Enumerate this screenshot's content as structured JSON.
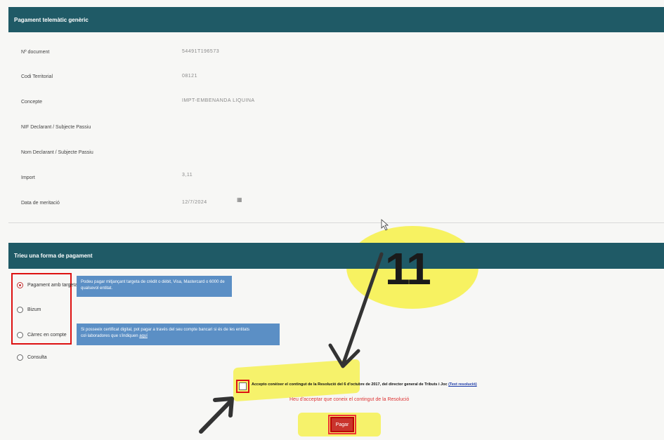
{
  "header": {
    "title": "Pagament telemàtic genèric"
  },
  "fields": [
    {
      "label": "Nº document",
      "value": "54491T196573"
    },
    {
      "label": "Codi Territorial",
      "value": "08121"
    },
    {
      "label": "Concepte",
      "value": "IMPT-EMBENANDA LIQUINA"
    },
    {
      "label": "NIF Declarant / Subjecte Passiu",
      "value": ""
    },
    {
      "label": "Nom Declarant / Subjecte Passiu",
      "value": ""
    },
    {
      "label": "Import",
      "value": "3,11"
    },
    {
      "label": "Data de meritació",
      "value": "12/7/2024"
    }
  ],
  "payment": {
    "title": "Trieu una forma de pagament",
    "options": [
      {
        "label": "Pagament amb targeta",
        "checked": true
      },
      {
        "label": "Bizum",
        "checked": false
      },
      {
        "label": "Càrrec en compte",
        "checked": false
      },
      {
        "label": "Consulta",
        "checked": false
      }
    ],
    "card_info": "Podeu pagar mitjançant targeta de crèdit o dèbit, Visa, Mastercard o 6000 de qualsevol entitat.",
    "account_info": "Si posseeix certificat digital, pot pagar a través del seu compte bancari si és de les entitats col·laboradores que s'indiquen",
    "account_link": "aquí"
  },
  "accept": {
    "text": "Accepto conèixer el contingut de la Resolució del 6 d'octubre de 2017, del director general de Tributs i Joc",
    "link": "(Text resolució)",
    "error": "Heu d'acceptar que coneix el contingut de la Resolució"
  },
  "pay_button": {
    "label": "Pagar"
  },
  "annotation": {
    "number": "11"
  }
}
